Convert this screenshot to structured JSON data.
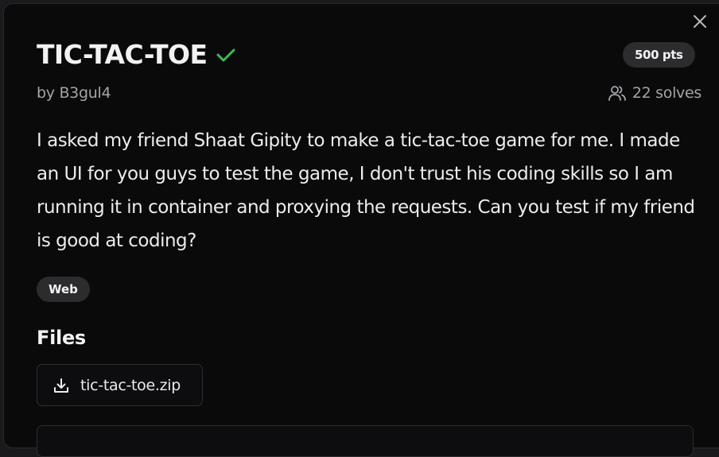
{
  "challenge": {
    "title": "TIC-TAC-TOE",
    "points": "500 pts",
    "author": "by B3gul4",
    "solves": "22 solves",
    "description": "I asked my friend Shaat Gipity to make a tic-tac-toe game for me. I made an UI for you guys to test the game, I don't trust his coding skills so I am running it in container and proxying the requests. Can you test if my friend is good at coding?",
    "tag": "Web",
    "solved": true
  },
  "files": {
    "heading": "Files",
    "items": [
      {
        "name": "tic-tac-toe.zip",
        "icon": "download-icon"
      }
    ]
  },
  "icons": {
    "close": "close-icon",
    "solved": "check-icon",
    "solves": "users-icon"
  },
  "colors": {
    "solved_check": "#3fb950",
    "background": "#0a0a0b",
    "chip": "#2c2c2f",
    "muted_text": "#a4a4aa"
  }
}
